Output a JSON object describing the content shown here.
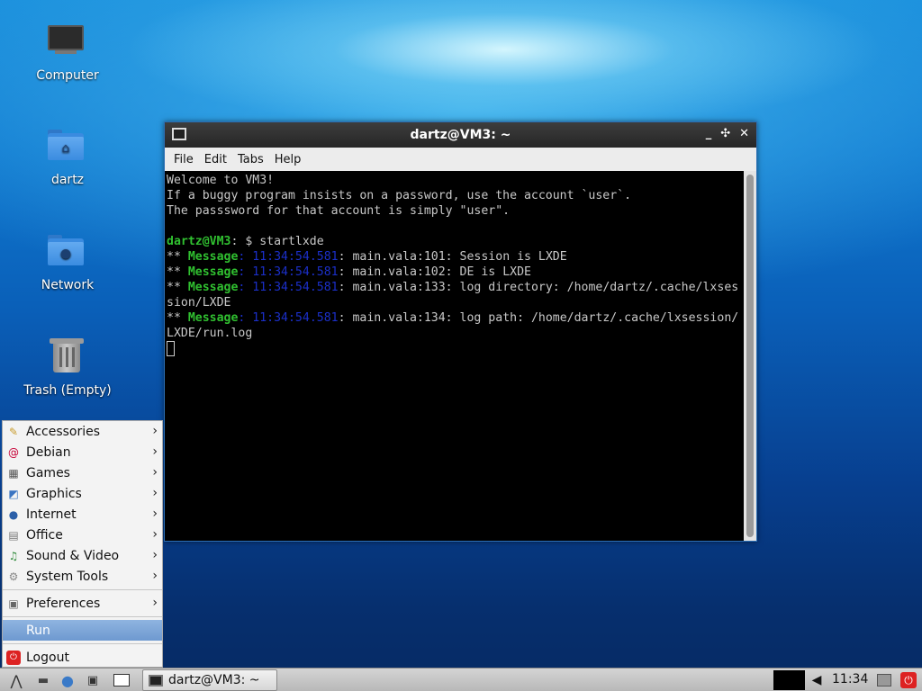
{
  "desktop": {
    "icons": [
      {
        "label": "Computer"
      },
      {
        "label": "dartz"
      },
      {
        "label": "Network"
      },
      {
        "label": "Trash (Empty)"
      }
    ]
  },
  "terminal": {
    "title": "dartz@VM3: ~",
    "menus": [
      "File",
      "Edit",
      "Tabs",
      "Help"
    ],
    "controls": {
      "minimize": "_",
      "maximize": "✣",
      "close": "✕"
    },
    "lines": {
      "l1": "Welcome to VM3!",
      "l2": "If a buggy program insists on a password, use the account `user`.",
      "l3": "The passsword for that account is simply \"user\".",
      "prompt_user": "dartz@VM3",
      "prompt_rest": ": $ startlxde",
      "msg_prefix": "** ",
      "msg_label": "Message",
      "msg_time": "11:34:54.581",
      "m1": ": main.vala:101: Session is LXDE",
      "m2": ": main.vala:102: DE is LXDE",
      "m3": ": main.vala:133: log directory: /home/dartz/.cache/lxses",
      "m3b": "sion/LXDE",
      "m4": ": main.vala:134: log path: /home/dartz/.cache/lxsession/",
      "m4b": "LXDE/run.log"
    }
  },
  "start_menu": {
    "items": [
      {
        "label": "Accessories",
        "icon": "accessories-icon"
      },
      {
        "label": "Debian",
        "icon": "debian-icon"
      },
      {
        "label": "Games",
        "icon": "games-icon"
      },
      {
        "label": "Graphics",
        "icon": "graphics-icon"
      },
      {
        "label": "Internet",
        "icon": "internet-icon"
      },
      {
        "label": "Office",
        "icon": "office-icon"
      },
      {
        "label": "Sound & Video",
        "icon": "sound-video-icon"
      },
      {
        "label": "System Tools",
        "icon": "system-tools-icon"
      }
    ],
    "preferences": "Preferences",
    "run": "Run",
    "logout": "Logout"
  },
  "taskbar": {
    "task_label": "dartz@VM3: ~",
    "clock": "11:34"
  }
}
